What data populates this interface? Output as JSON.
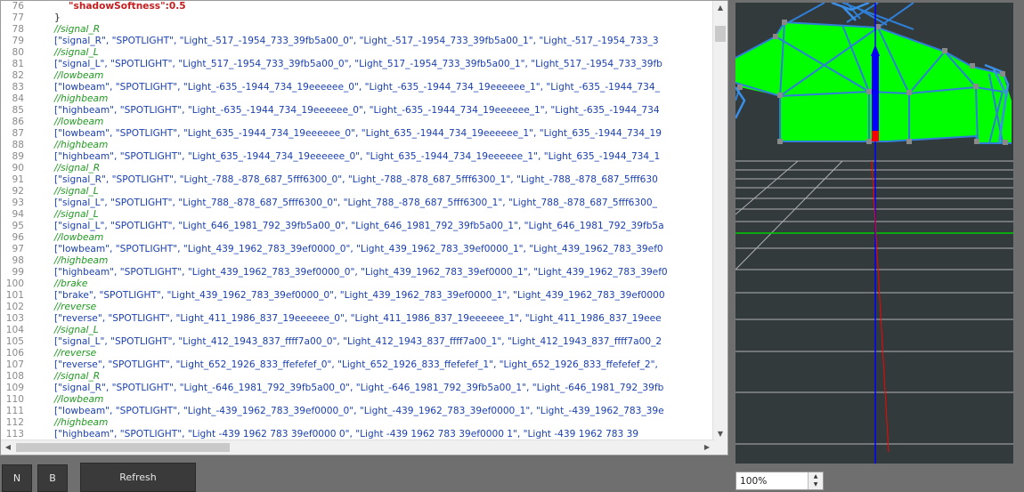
{
  "editor": {
    "lines": [
      {
        "num": "76",
        "kind": "key",
        "text": "\"shadowSoftness\":0.5",
        "indent": 2
      },
      {
        "num": "77",
        "kind": "plain",
        "text": "}",
        "indent": 1
      },
      {
        "num": "78",
        "kind": "comment",
        "text": "//signal_R",
        "indent": 0
      },
      {
        "num": "79",
        "kind": "code",
        "text": "[\"signal_R\", \"SPOTLIGHT\", \"Light_-517_-1954_733_39fb5a00_0\", \"Light_-517_-1954_733_39fb5a00_1\", \"Light_-517_-1954_733_3",
        "indent": 0
      },
      {
        "num": "80",
        "kind": "comment",
        "text": "//signal_L",
        "indent": 0
      },
      {
        "num": "81",
        "kind": "code",
        "text": "[\"signal_L\", \"SPOTLIGHT\", \"Light_517_-1954_733_39fb5a00_0\", \"Light_517_-1954_733_39fb5a00_1\", \"Light_517_-1954_733_39fb",
        "indent": 0
      },
      {
        "num": "82",
        "kind": "comment",
        "text": "//lowbeam",
        "indent": 0
      },
      {
        "num": "83",
        "kind": "code",
        "text": "[\"lowbeam\", \"SPOTLIGHT\", \"Light_-635_-1944_734_19eeeeee_0\", \"Light_-635_-1944_734_19eeeeee_1\", \"Light_-635_-1944_734_",
        "indent": 0
      },
      {
        "num": "84",
        "kind": "comment",
        "text": "//highbeam",
        "indent": 0
      },
      {
        "num": "85",
        "kind": "code",
        "text": "[\"highbeam\", \"SPOTLIGHT\", \"Light_-635_-1944_734_19eeeeee_0\", \"Light_-635_-1944_734_19eeeeee_1\", \"Light_-635_-1944_734",
        "indent": 0
      },
      {
        "num": "86",
        "kind": "comment",
        "text": "//lowbeam",
        "indent": 0
      },
      {
        "num": "87",
        "kind": "code",
        "text": "[\"lowbeam\", \"SPOTLIGHT\", \"Light_635_-1944_734_19eeeeee_0\", \"Light_635_-1944_734_19eeeeee_1\", \"Light_635_-1944_734_19",
        "indent": 0
      },
      {
        "num": "88",
        "kind": "comment",
        "text": "//highbeam",
        "indent": 0
      },
      {
        "num": "89",
        "kind": "code",
        "text": "[\"highbeam\", \"SPOTLIGHT\", \"Light_635_-1944_734_19eeeeee_0\", \"Light_635_-1944_734_19eeeeee_1\", \"Light_635_-1944_734_1",
        "indent": 0
      },
      {
        "num": "90",
        "kind": "comment",
        "text": "//signal_R",
        "indent": 0
      },
      {
        "num": "91",
        "kind": "code",
        "text": "[\"signal_R\", \"SPOTLIGHT\", \"Light_-788_-878_687_5fff6300_0\", \"Light_-788_-878_687_5fff6300_1\", \"Light_-788_-878_687_5fff630",
        "indent": 0
      },
      {
        "num": "92",
        "kind": "comment",
        "text": "//signal_L",
        "indent": 0
      },
      {
        "num": "93",
        "kind": "code",
        "text": "[\"signal_L\", \"SPOTLIGHT\", \"Light_788_-878_687_5fff6300_0\", \"Light_788_-878_687_5fff6300_1\", \"Light_788_-878_687_5fff6300_",
        "indent": 0
      },
      {
        "num": "94",
        "kind": "comment",
        "text": "//signal_L",
        "indent": 0
      },
      {
        "num": "95",
        "kind": "code",
        "text": "[\"signal_L\", \"SPOTLIGHT\", \"Light_646_1981_792_39fb5a00_0\", \"Light_646_1981_792_39fb5a00_1\", \"Light_646_1981_792_39fb5a",
        "indent": 0
      },
      {
        "num": "96",
        "kind": "comment",
        "text": "//lowbeam",
        "indent": 0
      },
      {
        "num": "97",
        "kind": "code",
        "text": "[\"lowbeam\", \"SPOTLIGHT\", \"Light_439_1962_783_39ef0000_0\", \"Light_439_1962_783_39ef0000_1\", \"Light_439_1962_783_39ef0",
        "indent": 0
      },
      {
        "num": "98",
        "kind": "comment",
        "text": "//highbeam",
        "indent": 0
      },
      {
        "num": "99",
        "kind": "code",
        "text": "[\"highbeam\", \"SPOTLIGHT\", \"Light_439_1962_783_39ef0000_0\", \"Light_439_1962_783_39ef0000_1\", \"Light_439_1962_783_39ef0",
        "indent": 0
      },
      {
        "num": "100",
        "kind": "comment",
        "text": "//brake",
        "indent": 0
      },
      {
        "num": "101",
        "kind": "code",
        "text": "[\"brake\", \"SPOTLIGHT\", \"Light_439_1962_783_39ef0000_0\", \"Light_439_1962_783_39ef0000_1\", \"Light_439_1962_783_39ef0000",
        "indent": 0
      },
      {
        "num": "102",
        "kind": "comment",
        "text": "//reverse",
        "indent": 0
      },
      {
        "num": "103",
        "kind": "code",
        "text": "[\"reverse\", \"SPOTLIGHT\", \"Light_411_1986_837_19eeeeee_0\", \"Light_411_1986_837_19eeeeee_1\", \"Light_411_1986_837_19eee",
        "indent": 0
      },
      {
        "num": "104",
        "kind": "comment",
        "text": "//signal_L",
        "indent": 0
      },
      {
        "num": "105",
        "kind": "code",
        "text": "[\"signal_L\", \"SPOTLIGHT\", \"Light_412_1943_837_ffff7a00_0\", \"Light_412_1943_837_ffff7a00_1\", \"Light_412_1943_837_ffff7a00_2",
        "indent": 0
      },
      {
        "num": "106",
        "kind": "comment",
        "text": "//reverse",
        "indent": 0
      },
      {
        "num": "107",
        "kind": "code",
        "text": "[\"reverse\", \"SPOTLIGHT\", \"Light_652_1926_833_ffefefef_0\", \"Light_652_1926_833_ffefefef_1\", \"Light_652_1926_833_ffefefef_2\",",
        "indent": 0
      },
      {
        "num": "108",
        "kind": "comment",
        "text": "//signal_R",
        "indent": 0
      },
      {
        "num": "109",
        "kind": "code",
        "text": "[\"signal_R\", \"SPOTLIGHT\", \"Light_-646_1981_792_39fb5a00_0\", \"Light_-646_1981_792_39fb5a00_1\", \"Light_-646_1981_792_39fb",
        "indent": 0
      },
      {
        "num": "110",
        "kind": "comment",
        "text": "//lowbeam",
        "indent": 0
      },
      {
        "num": "111",
        "kind": "code",
        "text": "[\"lowbeam\", \"SPOTLIGHT\", \"Light_-439_1962_783_39ef0000_0\", \"Light_-439_1962_783_39ef0000_1\", \"Light_-439_1962_783_39e",
        "indent": 0
      },
      {
        "num": "112",
        "kind": "comment",
        "text": "//highbeam",
        "indent": 0
      },
      {
        "num": "113",
        "kind": "code",
        "text": "[\"highbeam\", \"SPOTLIGHT\", \"Light -439 1962 783 39ef0000 0\", \"Light -439 1962 783 39ef0000 1\", \"Light -439 1962 783 39",
        "indent": 0
      }
    ]
  },
  "buttons": {
    "n_label": "N",
    "b_label": "B",
    "refresh_label": "Refresh"
  },
  "viewport": {
    "zoom_value": "100%",
    "colors": {
      "background": "#333a3c",
      "mesh_fill": "#00ff00",
      "wire": "#2f7fd8",
      "axis_blue": "#0000ff",
      "axis_red": "#ff0000",
      "axis_green": "#00cc00",
      "grid": "#c8c8c8"
    }
  }
}
